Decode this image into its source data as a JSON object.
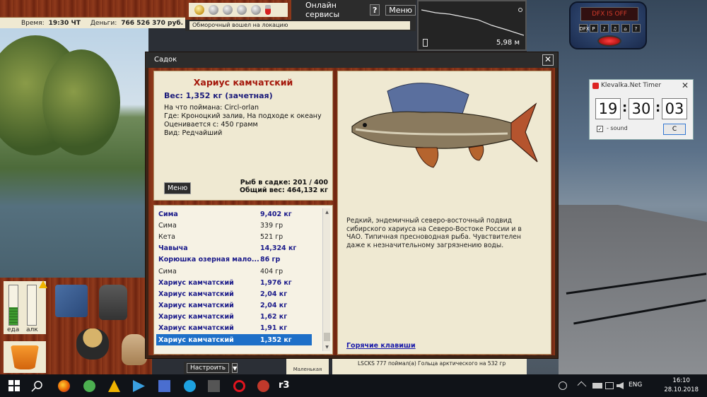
{
  "top_info": {
    "time_label": "Время:",
    "time_value": "19:30 ЧТ",
    "money_label": "Деньги:",
    "money_value": "766 526 370 руб."
  },
  "services": {
    "online_label": "Онлайн сервисы",
    "help_label": "?",
    "menu_label": "Меню"
  },
  "status_line": "Обморочный вошел на локацию",
  "depth": {
    "value": "5,98 м"
  },
  "dialog": {
    "title": "Садок",
    "close": "✕",
    "fish": {
      "name": "Хариус камчатский",
      "weight_line": "Вес: 1,352 кг (зачетная)",
      "bait": "На что поймана: Circl-orlan",
      "place": "Где: Кроноцкий залив, На подходе к океану",
      "rated": "Оценивается с: 450 грамм",
      "kind": "Вид: Редчайший"
    },
    "menu_button": "Меню",
    "count_line": "Рыб в садке: 201 / 400",
    "total_line": "Общий вес: 464,132 кг",
    "catch_list": [
      {
        "name": "Сима",
        "weight": "9,402 кг",
        "style": "bold"
      },
      {
        "name": "Сима",
        "weight": "339 гр",
        "style": "norm"
      },
      {
        "name": "Кета",
        "weight": "521 гр",
        "style": "norm"
      },
      {
        "name": "Чавыча",
        "weight": "14,324 кг",
        "style": "bold"
      },
      {
        "name": "Корюшка озерная мало...",
        "weight": "86 гр",
        "style": "bold"
      },
      {
        "name": "Сима",
        "weight": "404 гр",
        "style": "norm"
      },
      {
        "name": "Хариус камчатский",
        "weight": "1,976 кг",
        "style": "bold"
      },
      {
        "name": "Хариус камчатский",
        "weight": "2,04 кг",
        "style": "bold"
      },
      {
        "name": "Хариус камчатский",
        "weight": "2,04 кг",
        "style": "bold"
      },
      {
        "name": "Хариус камчатский",
        "weight": "1,62 кг",
        "style": "bold"
      },
      {
        "name": "Хариус камчатский",
        "weight": "1,91 кг",
        "style": "bold"
      },
      {
        "name": "Хариус камчатский",
        "weight": "1,352 кг",
        "style": "sel"
      }
    ],
    "description": "Редкий, эндемичный северо-восточный подвид сибирского хариуса на Северо-Востоке России и в ЧАО.  Типичная пресноводная рыба. Чувствителен даже к незначительному загрязнению воды.",
    "hotkeys": "Горячие клавиши"
  },
  "gauges": {
    "food_label": "еда",
    "alc_label": "алк",
    "food_level": 0.45,
    "alc_level": 0.0
  },
  "bottom": {
    "settings_label": "Настроить",
    "settings_arrow": "▼",
    "small_item_label": "Маленькая",
    "log_text": "LSCKS 777 поймал(а) Гольца арктического на 532 гр"
  },
  "gadget": {
    "screen_text": "DFX IS OFF",
    "buttons": [
      "DFX",
      "P",
      "♪",
      "♫",
      "⌂",
      "?"
    ]
  },
  "timer": {
    "title": "Klevalka.Net Timer",
    "close": "✕",
    "hours": "19",
    "minutes": "30",
    "seconds": "03",
    "sound_label": "- sound",
    "sound_checked": "✓",
    "c_button": "C"
  },
  "taskbar": {
    "lang": "ENG",
    "time": "16:10",
    "date": "28.10.2018"
  }
}
